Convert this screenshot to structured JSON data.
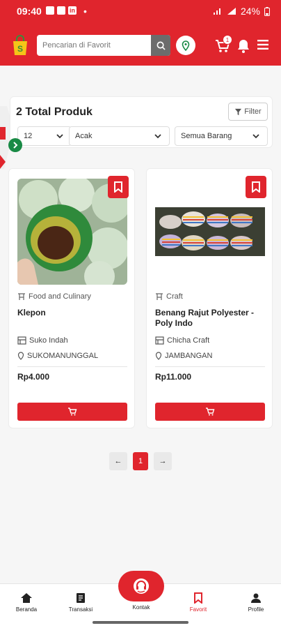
{
  "status": {
    "time": "09:40",
    "battery": "24%"
  },
  "header": {
    "search_placeholder": "Pencarian di Favorit",
    "cart_count": "1"
  },
  "listing": {
    "total_title": "2 Total Produk",
    "filter_label": "Filter",
    "per_page": "12",
    "sort": "Acak",
    "category": "Semua Barang"
  },
  "products": [
    {
      "category": "Food and Culinary",
      "name": "Klepon",
      "shop": "Suko Indah",
      "location": "SUKOMANUNGGAL",
      "price": "Rp4.000"
    },
    {
      "category": "Craft",
      "name": "Benang Rajut Polyester - Poly Indo",
      "shop": "Chicha Craft",
      "location": "JAMBANGAN",
      "price": "Rp11.000"
    }
  ],
  "pagination": {
    "prev": "←",
    "current": "1",
    "next": "→"
  },
  "bottom_nav": [
    {
      "label": "Beranda"
    },
    {
      "label": "Transaksi"
    },
    {
      "label": "Kontak"
    },
    {
      "label": "Favorit"
    },
    {
      "label": "Profile"
    }
  ],
  "colors": {
    "primary": "#e0252d",
    "accent_green": "#198a45"
  }
}
